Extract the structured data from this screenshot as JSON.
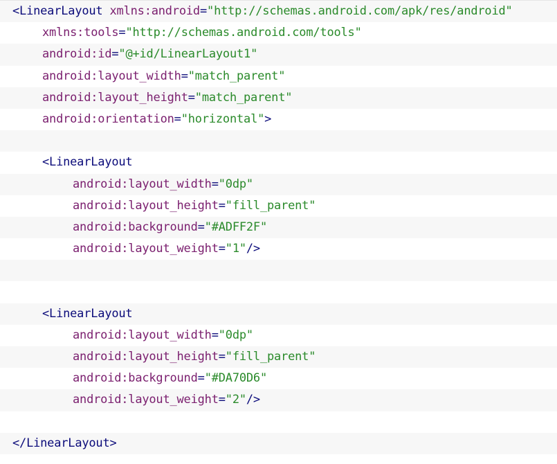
{
  "code": {
    "lines": [
      {
        "indent": 0,
        "tokens": [
          {
            "t": "tag",
            "v": "<LinearLayout"
          },
          {
            "t": "plain",
            "v": " "
          },
          {
            "t": "attr",
            "v": "xmlns:android"
          },
          {
            "t": "punct",
            "v": "="
          },
          {
            "t": "val",
            "v": "\"http://schemas.android.com/apk/res/android\""
          }
        ]
      },
      {
        "indent": 1,
        "tokens": [
          {
            "t": "attr",
            "v": "xmlns:tools"
          },
          {
            "t": "punct",
            "v": "="
          },
          {
            "t": "val",
            "v": "\"http://schemas.android.com/tools\""
          }
        ]
      },
      {
        "indent": 1,
        "tokens": [
          {
            "t": "attr",
            "v": "android:id"
          },
          {
            "t": "punct",
            "v": "="
          },
          {
            "t": "val",
            "v": "\"@+id/LinearLayout1\""
          }
        ]
      },
      {
        "indent": 1,
        "tokens": [
          {
            "t": "attr",
            "v": "android:layout_width"
          },
          {
            "t": "punct",
            "v": "="
          },
          {
            "t": "val",
            "v": "\"match_parent\""
          }
        ]
      },
      {
        "indent": 1,
        "tokens": [
          {
            "t": "attr",
            "v": "android:layout_height"
          },
          {
            "t": "punct",
            "v": "="
          },
          {
            "t": "val",
            "v": "\"match_parent\""
          }
        ]
      },
      {
        "indent": 1,
        "tokens": [
          {
            "t": "attr",
            "v": "android:orientation"
          },
          {
            "t": "punct",
            "v": "="
          },
          {
            "t": "val",
            "v": "\"horizontal\""
          },
          {
            "t": "tag",
            "v": ">"
          }
        ]
      },
      {
        "indent": 0,
        "tokens": []
      },
      {
        "indent": 1,
        "tokens": [
          {
            "t": "tag",
            "v": "<LinearLayout"
          }
        ]
      },
      {
        "indent": 2,
        "tokens": [
          {
            "t": "attr",
            "v": "android:layout_width"
          },
          {
            "t": "punct",
            "v": "="
          },
          {
            "t": "val",
            "v": "\"0dp\""
          }
        ]
      },
      {
        "indent": 2,
        "tokens": [
          {
            "t": "attr",
            "v": "android:layout_height"
          },
          {
            "t": "punct",
            "v": "="
          },
          {
            "t": "val",
            "v": "\"fill_parent\""
          }
        ]
      },
      {
        "indent": 2,
        "tokens": [
          {
            "t": "attr",
            "v": "android:background"
          },
          {
            "t": "punct",
            "v": "="
          },
          {
            "t": "val",
            "v": "\"#ADFF2F\""
          }
        ]
      },
      {
        "indent": 2,
        "tokens": [
          {
            "t": "attr",
            "v": "android:layout_weight"
          },
          {
            "t": "punct",
            "v": "="
          },
          {
            "t": "val",
            "v": "\"1\""
          },
          {
            "t": "tag",
            "v": "/>"
          }
        ]
      },
      {
        "indent": 0,
        "tokens": []
      },
      {
        "indent": 0,
        "tokens": []
      },
      {
        "indent": 1,
        "tokens": [
          {
            "t": "tag",
            "v": "<LinearLayout"
          }
        ]
      },
      {
        "indent": 2,
        "tokens": [
          {
            "t": "attr",
            "v": "android:layout_width"
          },
          {
            "t": "punct",
            "v": "="
          },
          {
            "t": "val",
            "v": "\"0dp\""
          }
        ]
      },
      {
        "indent": 2,
        "tokens": [
          {
            "t": "attr",
            "v": "android:layout_height"
          },
          {
            "t": "punct",
            "v": "="
          },
          {
            "t": "val",
            "v": "\"fill_parent\""
          }
        ]
      },
      {
        "indent": 2,
        "tokens": [
          {
            "t": "attr",
            "v": "android:background"
          },
          {
            "t": "punct",
            "v": "="
          },
          {
            "t": "val",
            "v": "\"#DA70D6\""
          }
        ]
      },
      {
        "indent": 2,
        "tokens": [
          {
            "t": "attr",
            "v": "android:layout_weight"
          },
          {
            "t": "punct",
            "v": "="
          },
          {
            "t": "val",
            "v": "\"2\""
          },
          {
            "t": "tag",
            "v": "/>"
          }
        ]
      },
      {
        "indent": 0,
        "tokens": []
      },
      {
        "indent": 0,
        "tokens": [
          {
            "t": "tag",
            "v": "</LinearLayout>"
          }
        ]
      }
    ]
  },
  "colors": {
    "tag": "#0b0b7a",
    "attribute": "#7a1e6e",
    "value": "#2a8a2a",
    "row_alt": "#f7f7f7",
    "row_base": "#ffffff"
  }
}
